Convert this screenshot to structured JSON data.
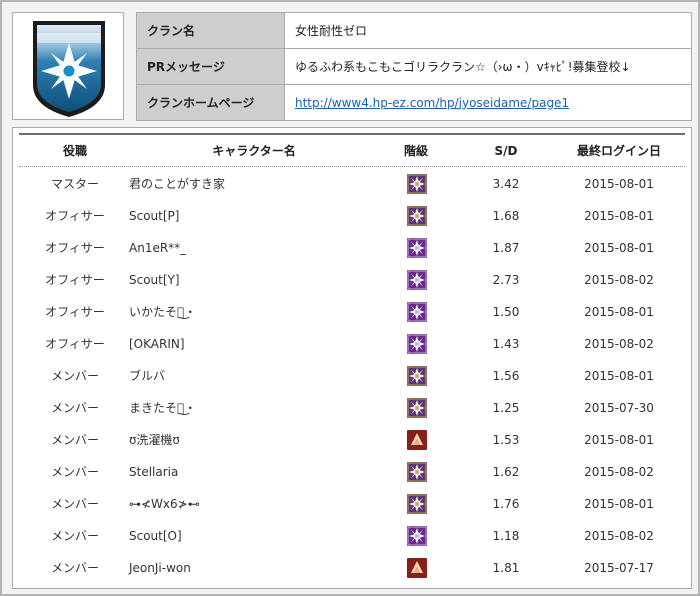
{
  "clan": {
    "fields": [
      {
        "label": "クラン名",
        "value": "女性耐性ゼロ"
      },
      {
        "label": "PRメッセージ",
        "value": "ゆるふわ系もこもこゴリラクラン☆（›ω・）vｷｬﾋﾟ!募集登校↓"
      },
      {
        "label": "クランホームページ",
        "value": "http://www4.hp-ez.com/hp/jyoseidame/page1"
      }
    ],
    "emblem": "shield-star-emblem"
  },
  "roster": {
    "headers": {
      "role": "役職",
      "name": "キャラクター名",
      "rank": "階級",
      "sd": "S/D",
      "last_login": "最終ログイン日"
    },
    "members": [
      {
        "role": "マスター",
        "name": "君のことがすき家",
        "rank_icon": "rank-gold-star-icon",
        "sd": "3.42",
        "last_login": "2015-08-01"
      },
      {
        "role": "オフィサー",
        "name": "Scout[P]",
        "rank_icon": "rank-gold-star-icon",
        "sd": "1.68",
        "last_login": "2015-08-01"
      },
      {
        "role": "オフィサー",
        "name": "An1eR**_",
        "rank_icon": "rank-purple-star-icon",
        "sd": "1.87",
        "last_login": "2015-08-01"
      },
      {
        "role": "オフィサー",
        "name": "Scout[Y]",
        "rank_icon": "rank-purple-star-icon",
        "sd": "2.73",
        "last_login": "2015-08-02"
      },
      {
        "role": "オフィサー",
        "name": "いかたそ・͜・",
        "rank_icon": "rank-purple-star-icon",
        "sd": "1.50",
        "last_login": "2015-08-01"
      },
      {
        "role": "オフィサー",
        "name": "[OKARIN]",
        "rank_icon": "rank-purple-star-icon",
        "sd": "1.43",
        "last_login": "2015-08-02"
      },
      {
        "role": "メンバー",
        "name": "ブルバ",
        "rank_icon": "rank-gold-star-icon",
        "sd": "1.56",
        "last_login": "2015-08-01"
      },
      {
        "role": "メンバー",
        "name": "まきたそ・͜・",
        "rank_icon": "rank-gold-star-icon",
        "sd": "1.25",
        "last_login": "2015-07-30"
      },
      {
        "role": "メンバー",
        "name": "ʊ洗濯機ʊ",
        "rank_icon": "rank-red-chevron-icon",
        "sd": "1.53",
        "last_login": "2015-08-01"
      },
      {
        "role": "メンバー",
        "name": "Stellaria",
        "rank_icon": "rank-gold-star-icon",
        "sd": "1.62",
        "last_login": "2015-08-02"
      },
      {
        "role": "メンバー",
        "name": "⊶≮Wx6≯⊷",
        "rank_icon": "rank-gold-star-icon",
        "sd": "1.76",
        "last_login": "2015-08-01"
      },
      {
        "role": "メンバー",
        "name": "Scout[O]",
        "rank_icon": "rank-purple-star-icon",
        "sd": "1.18",
        "last_login": "2015-08-02"
      },
      {
        "role": "メンバー",
        "name": "JeonJi-won",
        "rank_icon": "rank-red-chevron-icon",
        "sd": "1.81",
        "last_login": "2015-07-17"
      }
    ]
  },
  "colors": {
    "label_bg": "#cecece",
    "link": "#1a5fb4",
    "gold_rank": "#c7a23a",
    "purple_rank": "#6a2a8c",
    "red_rank": "#8a1e1e"
  }
}
